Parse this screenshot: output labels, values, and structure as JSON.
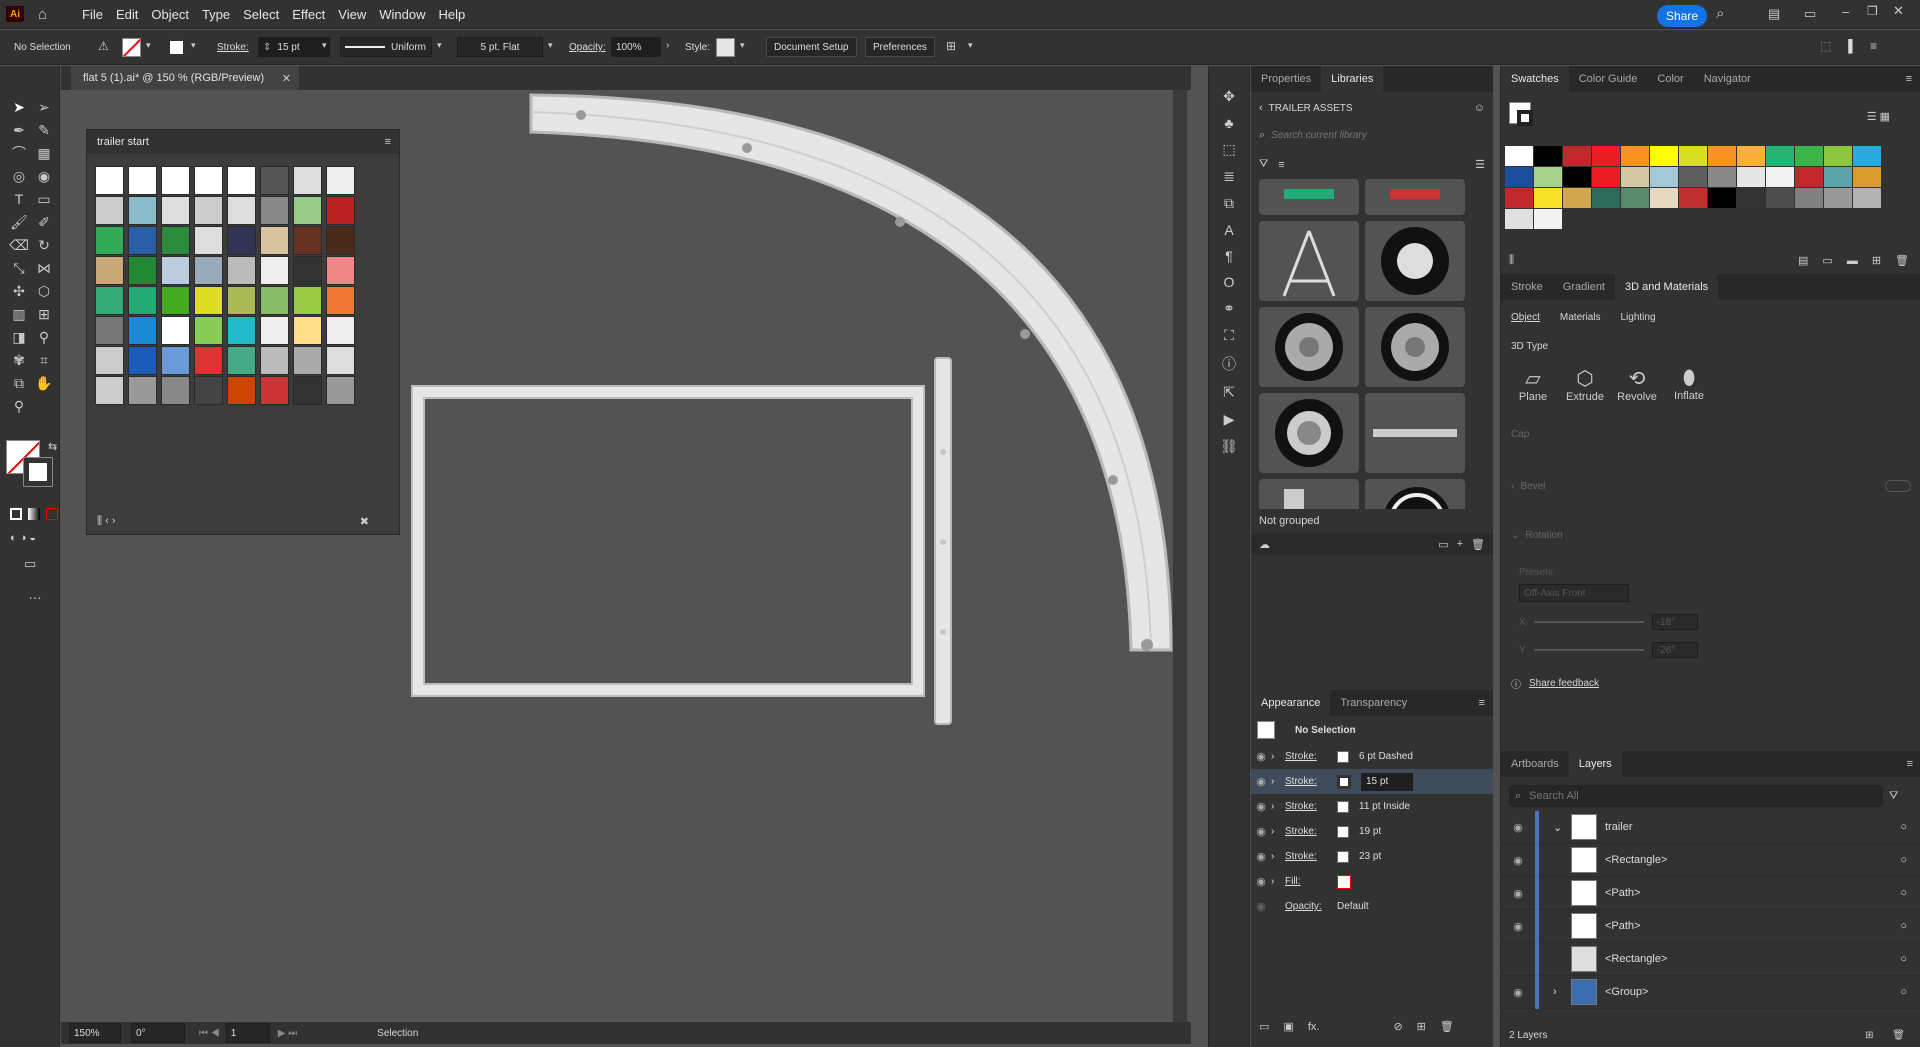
{
  "menubar": {
    "app_logo": "Ai",
    "items": [
      "File",
      "Edit",
      "Object",
      "Type",
      "Select",
      "Effect",
      "View",
      "Window",
      "Help"
    ],
    "share_label": "Share"
  },
  "control": {
    "selection": "No Selection",
    "stroke_label": "Stroke:",
    "stroke_value": "15 pt",
    "profile": "Uniform",
    "brush": "5 pt. Flat",
    "opacity_label": "Opacity:",
    "opacity_value": "100%",
    "style_label": "Style:",
    "doc_setup": "Document Setup",
    "preferences": "Preferences"
  },
  "document": {
    "tab_title": "flat 5 (1).ai* @ 150 % (RGB/Preview)"
  },
  "status": {
    "zoom": "150%",
    "rotation": "0°",
    "artboard": "1",
    "tool": "Selection"
  },
  "swatch_panel": {
    "title": "trailer start"
  },
  "libraries": {
    "tabs": [
      "Properties",
      "Libraries"
    ],
    "library_name": "TRAILER ASSETS",
    "search_placeholder": "Search current library",
    "group_label": "Not grouped"
  },
  "appearance": {
    "tabs": [
      "Appearance",
      "Transparency"
    ],
    "selection": "No Selection",
    "rows": [
      {
        "label": "Stroke:",
        "value": "6 pt Dashed"
      },
      {
        "label": "Stroke:",
        "value": "15 pt"
      },
      {
        "label": "Stroke:",
        "value": "11 pt  Inside"
      },
      {
        "label": "Stroke:",
        "value": "19 pt"
      },
      {
        "label": "Stroke:",
        "value": "23 pt"
      },
      {
        "label": "Fill:",
        "value": ""
      },
      {
        "label": "Opacity:",
        "value": "Default"
      }
    ]
  },
  "swatches": {
    "tabs": [
      "Swatches",
      "Color Guide",
      "Color",
      "Navigator"
    ],
    "colors": [
      "#ffffff",
      "#000000",
      "#c1272d",
      "#ed1c24",
      "#f7931e",
      "#ffff00",
      "#d9e021",
      "#f7931e",
      "#fbb03b",
      "#22b573",
      "#39b54a",
      "#8cc63f",
      "#29abe2",
      "#1b4f9c",
      "#a9d18e",
      "#000000",
      "#ed1c24",
      "#d4c7a3",
      "#a3c8d8",
      "#5e5e5e",
      "#888888",
      "#e6e6e6",
      "#f2f2f2",
      "#c1272d",
      "#5ea3a7",
      "#d99b2b",
      "#c1272d",
      "#f7e02a",
      "#d1a84e",
      "#2d6a57",
      "#5b8a6b",
      "#e6d8c2",
      "#c03030",
      "#000000",
      "#333333",
      "#4d4d4d",
      "#808080",
      "#999999",
      "#b3b3b3",
      "#e0e0e0",
      "#f2f2f2"
    ]
  },
  "materials": {
    "tabs": [
      "Stroke",
      "Gradient",
      "3D and Materials"
    ],
    "subtabs": [
      "Object",
      "Materials",
      "Lighting"
    ],
    "section": "3D Type",
    "types": [
      "Plane",
      "Extrude",
      "Revolve",
      "Inflate"
    ],
    "cap": "Cap",
    "bevel": "Bevel",
    "rotation": "Rotation",
    "presets_label": "Presets",
    "preset_value": "Off-Axis Front",
    "x_value": "-18°",
    "y_value": "-26°",
    "feedback": "Share feedback"
  },
  "layers": {
    "tabs": [
      "Artboards",
      "Layers"
    ],
    "search_placeholder": "Search All",
    "items": [
      "trailer",
      "<Rectangle>",
      "<Path>",
      "<Path>",
      "<Rectangle>",
      "<Group>"
    ],
    "count": "2 Layers"
  }
}
